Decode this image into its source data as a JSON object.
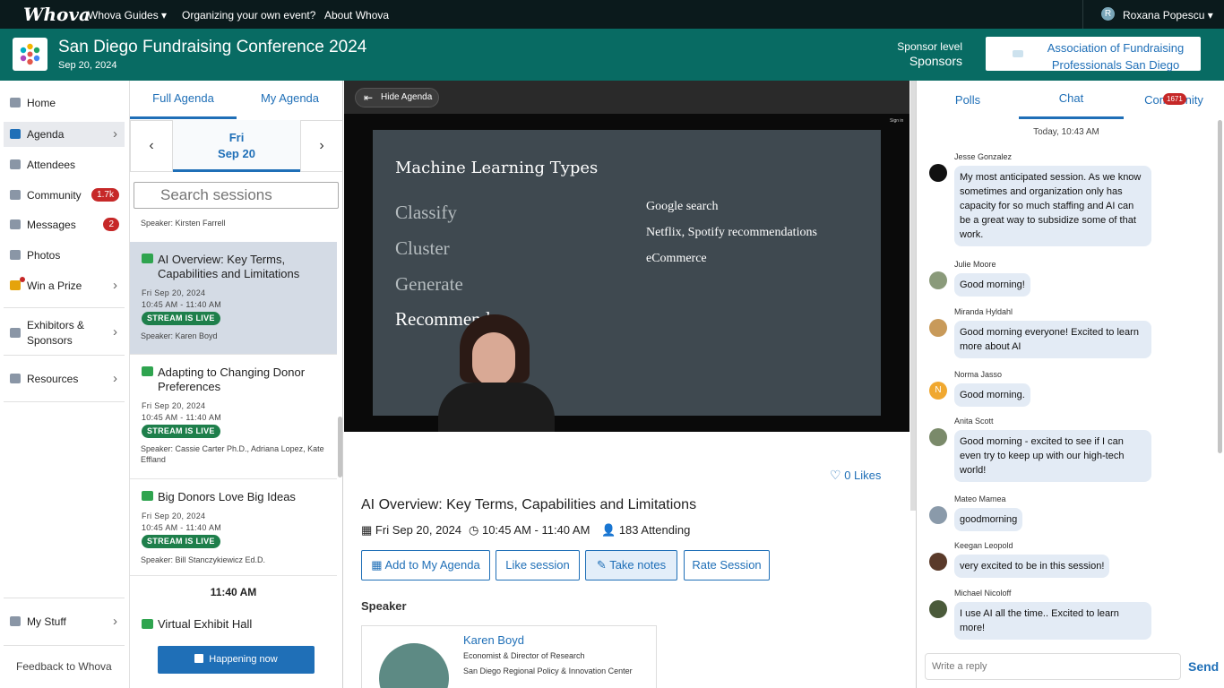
{
  "topnav": {
    "logo": "Whova",
    "guides": "Whova Guides ▾",
    "organizing": "Organizing your own event?",
    "about": "About Whova",
    "user_initial": "R",
    "user_name": "Roxana Popescu ▾"
  },
  "header": {
    "title": "San Diego Fundraising Conference 2024",
    "date": "Sep 20, 2024",
    "sponsor_level_label": "Sponsor level",
    "sponsor_level": "Sponsors",
    "sponsor_name": "Association of Fundraising Professionals San Diego"
  },
  "sidebar": {
    "items": [
      {
        "label": "Home",
        "icon": "home-icon"
      },
      {
        "label": "Agenda",
        "icon": "calendar-icon",
        "chevron": "›"
      },
      {
        "label": "Attendees",
        "icon": "people-icon"
      },
      {
        "label": "Community",
        "icon": "chat-icon",
        "badge": "1.7k"
      },
      {
        "label": "Messages",
        "icon": "envelope-icon",
        "badge": "2"
      },
      {
        "label": "Photos",
        "icon": "camera-icon"
      },
      {
        "label": "Win a Prize",
        "icon": "trophy-icon",
        "chevron": "›"
      },
      {
        "label": "Exhibitors & Sponsors",
        "icon": "booth-icon",
        "chevron": "›"
      },
      {
        "label": "Resources",
        "icon": "briefcase-icon",
        "chevron": "›"
      },
      {
        "label": "My Stuff",
        "icon": "person-icon",
        "chevron": "›"
      }
    ],
    "feedback": "Feedback to Whova"
  },
  "agenda": {
    "tabs": [
      "Full Agenda",
      "My Agenda"
    ],
    "prev": "‹",
    "next": "›",
    "day": "Fri",
    "date": "Sep 20",
    "search_placeholder": "Search sessions",
    "prev_speaker": "Speaker: Kirsten Farrell",
    "sessions": [
      {
        "title": "AI Overview: Key Terms, Capabilities and Limitations",
        "date": "Fri Sep 20, 2024",
        "time": "10:45 AM - 11:40 AM",
        "live": "STREAM IS LIVE",
        "speaker": "Speaker: Karen Boyd"
      },
      {
        "title": "Adapting to Changing Donor Preferences",
        "date": "Fri Sep 20, 2024",
        "time": "10:45 AM - 11:40 AM",
        "live": "STREAM IS LIVE",
        "speaker": "Speaker: Cassie Carter Ph.D., Adriana Lopez, Kate Effland"
      },
      {
        "title": "Big Donors Love Big Ideas",
        "date": "Fri Sep 20, 2024",
        "time": "10:45 AM - 11:40 AM",
        "live": "STREAM IS LIVE",
        "speaker": "Speaker: Bill Stanczykiewicz Ed.D."
      }
    ],
    "time_heading": "11:40 AM",
    "exhibit_title": "Virtual Exhibit Hall",
    "happening": "Happening now"
  },
  "main": {
    "hide_agenda": "Hide Agenda",
    "slide": {
      "heading": "Machine Learning Types",
      "left": [
        "Classify",
        "Cluster",
        "Generate",
        "Recommend"
      ],
      "right": [
        "Google search",
        "Netflix, Spotify recommendations",
        "eCommerce"
      ],
      "signin": "Sign in"
    },
    "likes": "0 Likes",
    "session_title": "AI Overview: Key Terms, Capabilities and Limitations",
    "date": "Fri Sep 20, 2024",
    "time": "10:45 AM - 11:40 AM",
    "attending": "183 Attending",
    "buttons": {
      "add": "Add to My Agenda",
      "like": "Like session",
      "notes": "Take notes",
      "rate": "Rate Session"
    },
    "speaker_heading": "Speaker",
    "speaker": {
      "name": "Karen Boyd",
      "role": "Economist & Director of Research",
      "org": "San Diego Regional Policy & Innovation Center"
    }
  },
  "right": {
    "tabs": [
      "Polls",
      "Chat",
      "Community"
    ],
    "community_badge": "1671",
    "day_label": "Today, 10:43 AM",
    "messages": [
      {
        "name": "Jesse Gonzalez",
        "text": "My most anticipated session. As we know sometimes and organization only has capacity for so much staffing and AI can be a great way to subsidize some of that work."
      },
      {
        "name": "Julie Moore",
        "text": "Good morning!"
      },
      {
        "name": "Miranda Hyldahl",
        "text": "Good morning everyone! Excited to learn more about AI"
      },
      {
        "name": "Norma Jasso",
        "text": "Good morning.",
        "initial": "N"
      },
      {
        "name": "Anita Scott",
        "text": "Good morning - excited to see if I can even try to keep up with our high-tech world!"
      },
      {
        "name": "Mateo Mamea",
        "text": "goodmorning"
      },
      {
        "name": "Keegan Leopold",
        "text": "very excited to be in this session!"
      },
      {
        "name": "Michael Nicoloff",
        "text": "I use AI all the time.. Excited to learn more!"
      }
    ],
    "reply_placeholder": "Write a reply",
    "send": "Send"
  },
  "colors": {
    "header": "#086b63",
    "topnav": "#0b1a1c",
    "accent": "#1f6fb7",
    "live": "#1e7f4b",
    "badge": "#c62828"
  }
}
